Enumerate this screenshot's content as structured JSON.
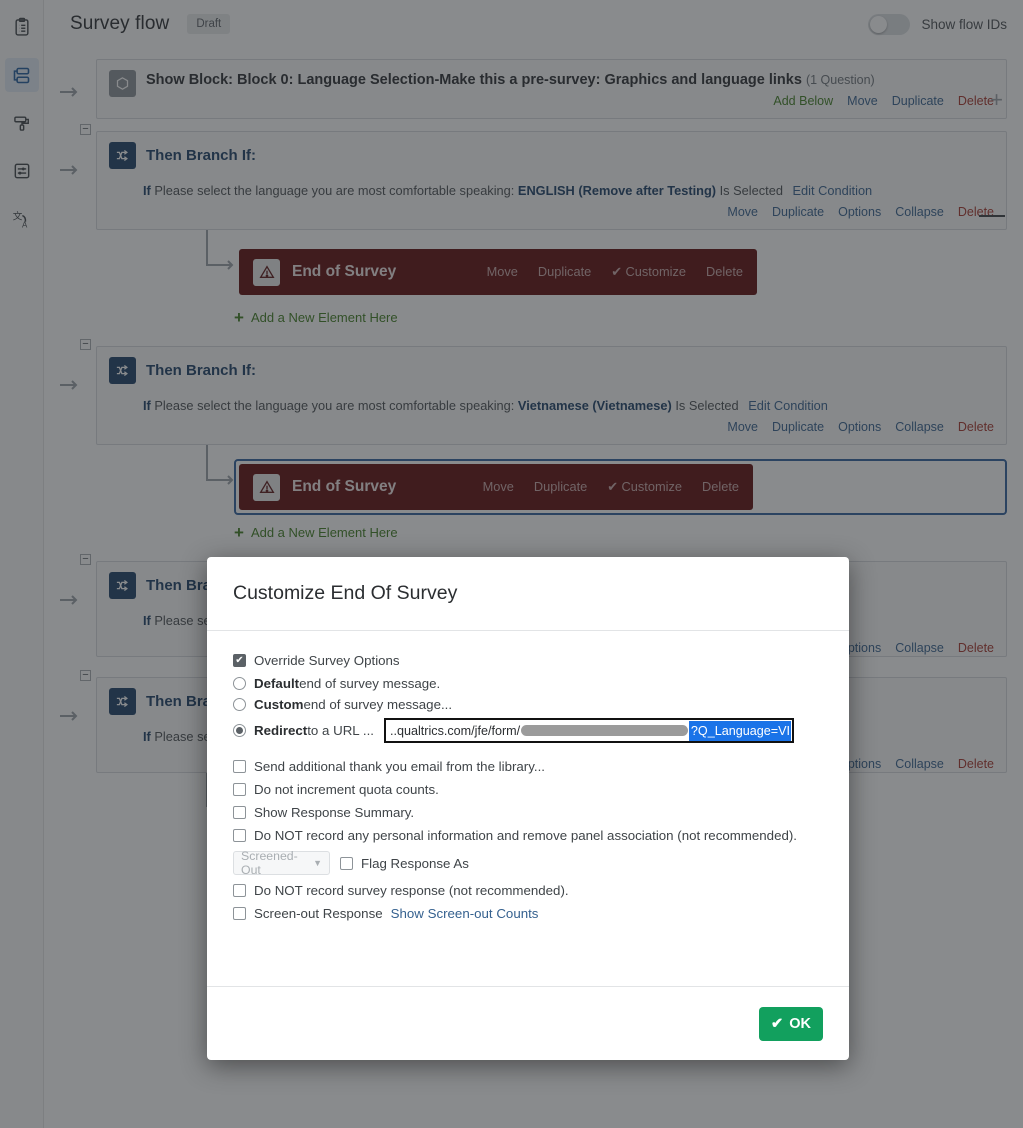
{
  "sidebar": {
    "items": [
      {
        "name": "survey",
        "icon": "clipboard-icon",
        "active": false
      },
      {
        "name": "flow",
        "icon": "flow-icon",
        "active": true
      },
      {
        "name": "look-and-feel",
        "icon": "paint-roller-icon",
        "active": false
      },
      {
        "name": "survey-options",
        "icon": "sliders-icon",
        "active": false
      },
      {
        "name": "translations",
        "icon": "translate-icon",
        "active": false
      }
    ]
  },
  "header": {
    "title": "Survey flow",
    "status_badge": "Draft",
    "toggle_label": "Show flow IDs",
    "toggle_on": false
  },
  "flow": {
    "block": {
      "title": "Show Block: Block 0: Language Selection-Make this a pre-survey: Graphics and language links",
      "question_count": "(1 Question)",
      "actions": {
        "add_below": "Add Below",
        "move": "Move",
        "duplicate": "Duplicate",
        "delete": "Delete"
      }
    },
    "branch_label": "Then Branch If:",
    "branch_label_clipped": "Then B",
    "if_word": "If",
    "condition_prefix": "Please select the language you are most comfortable speaking:",
    "condition_prefix_clipped": "Pl",
    "is_selected": "Is Selected",
    "edit_condition": "Edit Condition",
    "branch_actions": {
      "move": "Move",
      "duplicate": "Duplicate",
      "options": "Options",
      "options_clipped": "ptions",
      "collapse": "Collapse",
      "delete": "Delete"
    },
    "branches": [
      {
        "value": "ENGLISH (Remove after Testing)"
      },
      {
        "value": "Vietnamese (Vietnamese)"
      }
    ],
    "end_of_survey": {
      "title": "End of Survey",
      "actions": {
        "move": "Move",
        "duplicate": "Duplicate",
        "customize": "Customize",
        "delete": "Delete"
      },
      "customize_check": "✔"
    },
    "add_element": "Add a New Element Here",
    "collapse_glyph": "−"
  },
  "modal": {
    "title": "Customize End Of Survey",
    "override": {
      "label": "Override Survey Options",
      "checked": true
    },
    "message_options": [
      {
        "bold": "Default",
        "rest": " end of survey message.",
        "selected": false
      },
      {
        "bold": "Custom",
        "rest": " end of survey message...",
        "selected": false
      },
      {
        "bold": "Redirect",
        "rest": " to a URL ...",
        "selected": true
      }
    ],
    "url": {
      "prefix": "..qualtrics.com/jfe/form/",
      "redacted": true,
      "selection": "?Q_Language=VI"
    },
    "checkboxes": [
      {
        "label": "Send additional thank you email from the library...",
        "checked": false
      },
      {
        "label": "Do not increment quota counts.",
        "checked": false
      },
      {
        "label": "Show Response Summary.",
        "checked": false
      },
      {
        "label": "Do NOT record any personal information and remove panel association (not recommended).",
        "checked": false
      }
    ],
    "flag_row": {
      "select_value": "Screened-Out",
      "select_disabled": true,
      "label": "Flag Response As",
      "checked": false
    },
    "checkboxes_tail": [
      {
        "label": "Do NOT record survey response (not recommended).",
        "checked": false
      }
    ],
    "screenout": {
      "label": "Screen-out Response",
      "checked": false,
      "link": "Show Screen-out Counts"
    },
    "ok_button": {
      "label": "OK",
      "check_glyph": "✔"
    }
  },
  "colors": {
    "accent_blue": "#1c3f66",
    "green_ok": "#12a05e",
    "eos_red": "#5e0b0b",
    "link_blue": "#35618f",
    "delete_red": "#a6342b",
    "selection_blue": "#1a73e8"
  }
}
